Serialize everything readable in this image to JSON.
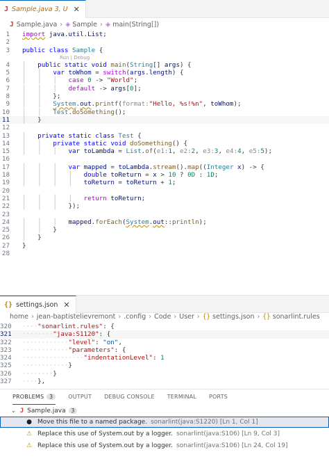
{
  "editor1": {
    "tab": {
      "name": "Sample.java 3, U",
      "icon": "J"
    },
    "breadcrumb": [
      "Sample.java",
      "Sample",
      "main(String[])"
    ],
    "codelens": "Run | Debug",
    "lines": [
      {
        "n": "1",
        "html": "<span class=\"kw2 warn\">import</span> <span class=\"var\">java.util.List</span>;"
      },
      {
        "n": "2",
        "html": ""
      },
      {
        "n": "3",
        "html": "<span class=\"kw\">public</span> <span class=\"kw\">class</span> <span class=\"typ\">Sample</span> {"
      },
      {
        "n": "4",
        "html": "<span class=\"gl\">│</span>   <span class=\"kw\">public</span> <span class=\"kw\">static</span> <span class=\"kw\">void</span> <span class=\"fn\">main</span>(<span class=\"typ\">String</span>[] <span class=\"var\">args</span>) {",
        "lens": true
      },
      {
        "n": "5",
        "html": "<span class=\"gl\">│</span>   <span class=\"gl\">│</span>   <span class=\"kw\">var</span> <span class=\"var\">toWhom</span> = <span class=\"kw2\">switch</span>(<span class=\"var\">args</span>.<span class=\"var\">length</span>) {"
      },
      {
        "n": "6",
        "html": "<span class=\"gl\">│</span>   <span class=\"gl\">│</span>   <span class=\"gl\">│</span>   <span class=\"kw2\">case</span> <span class=\"num\">0</span> -> <span class=\"str\">\"World\"</span>;"
      },
      {
        "n": "7",
        "html": "<span class=\"gl\">│</span>   <span class=\"gl\">│</span>   <span class=\"gl\">│</span>   <span class=\"kw2\">default</span> -> <span class=\"var\">args</span>[<span class=\"num\">0</span>];"
      },
      {
        "n": "8",
        "html": "<span class=\"gl\">│</span>   <span class=\"gl\">│</span>   };"
      },
      {
        "n": "9",
        "html": "<span class=\"gl\">│</span>   <span class=\"gl\">│</span>   <span class=\"typ warn\">System</span>.<span class=\"var warn\">out</span>.<span class=\"fn\">printf</span>(<span class=\"hint\">format:</span><span class=\"str\">\"Hello, %s!%n\"</span>, <span class=\"var\">toWhom</span>);"
      },
      {
        "n": "10",
        "html": "<span class=\"gl\">│</span>   <span class=\"gl\">│</span>   <span class=\"typ\">Test</span>.<span class=\"fn\">doSomething</span>();"
      },
      {
        "n": "11",
        "html": "<span class=\"gl\">│</span>   }",
        "current": true
      },
      {
        "n": "12",
        "html": ""
      },
      {
        "n": "13",
        "html": "<span class=\"gl\">│</span>   <span class=\"kw\">private</span> <span class=\"kw\">static</span> <span class=\"kw\">class</span> <span class=\"typ\">Test</span> {"
      },
      {
        "n": "14",
        "html": "<span class=\"gl\">│</span>   <span class=\"gl\">│</span>   <span class=\"kw\">private</span> <span class=\"kw\">static</span> <span class=\"kw\">void</span> <span class=\"fn\">doSomething</span>() {"
      },
      {
        "n": "15",
        "html": "<span class=\"gl\">│</span>   <span class=\"gl\">│</span>   <span class=\"gl\">│</span>   <span class=\"kw\">var</span> <span class=\"var\">toLambda</span> = <span class=\"typ\">List</span>.<span class=\"fn\">of</span>(<span class=\"hint\">e1:</span><span class=\"num\">1</span>, <span class=\"hint\">e2:</span><span class=\"num\">2</span>, <span class=\"hint\">e3:</span><span class=\"num\">3</span>, <span class=\"hint\">e4:</span><span class=\"num\">4</span>, <span class=\"hint\">e5:</span><span class=\"num\">5</span>);"
      },
      {
        "n": "16",
        "html": ""
      },
      {
        "n": "17",
        "html": "<span class=\"gl\">│</span>   <span class=\"gl\">│</span>   <span class=\"gl\">│</span>   <span class=\"kw\">var</span> <span class=\"var\">mapped</span> = <span class=\"var\">toLambda</span>.<span class=\"fn\">stream</span>().<span class=\"fn\">map</span>((<span class=\"typ\">Integer</span> <span class=\"var\">x</span>) -> {"
      },
      {
        "n": "18",
        "html": "<span class=\"gl\">│</span>   <span class=\"gl\">│</span>   <span class=\"gl\">│</span>   <span class=\"gl\">│</span>   <span class=\"kw\">double</span> <span class=\"var\">toReturn</span> = <span class=\"var\">x</span> > <span class=\"num\">10</span> ? <span class=\"num\">0D</span> : <span class=\"num\">1D</span>;"
      },
      {
        "n": "19",
        "html": "<span class=\"gl\">│</span>   <span class=\"gl\">│</span>   <span class=\"gl\">│</span>   <span class=\"gl\">│</span>   <span class=\"var\">toReturn</span> = <span class=\"var\">toReturn</span> + <span class=\"num\">1</span>;"
      },
      {
        "n": "20",
        "html": ""
      },
      {
        "n": "21",
        "html": "<span class=\"gl\">│</span>   <span class=\"gl\">│</span>   <span class=\"gl\">│</span>   <span class=\"gl\">│</span>   <span class=\"kw2\">return</span> <span class=\"var\">toReturn</span>;"
      },
      {
        "n": "22",
        "html": "<span class=\"gl\">│</span>   <span class=\"gl\">│</span>   <span class=\"gl\">│</span>   });"
      },
      {
        "n": "23",
        "html": ""
      },
      {
        "n": "24",
        "html": "<span class=\"gl\">│</span>   <span class=\"gl\">│</span>   <span class=\"gl\">│</span>   <span class=\"var\">mapped</span>.<span class=\"fn\">forEach</span>(<span class=\"typ warn\">System</span>.<span class=\"var warn\">out</span>::<span class=\"fn\">println</span>);"
      },
      {
        "n": "25",
        "html": "<span class=\"gl\">│</span>   <span class=\"gl\">│</span>   }"
      },
      {
        "n": "26",
        "html": "<span class=\"gl\">│</span>   }"
      },
      {
        "n": "27",
        "html": "}"
      },
      {
        "n": "28",
        "html": ""
      }
    ]
  },
  "editor2": {
    "tab": {
      "name": "settings.json",
      "icon": "{}"
    },
    "breadcrumb": [
      "home",
      "jean-baptistelievremont",
      ".config",
      "Code",
      "User",
      "settings.json",
      "sonarlint.rules"
    ],
    "lines": [
      {
        "n": "320",
        "html": "<span class=\"dots\">····</span><span class=\"jkey\">\"sonarlint.rules\"</span>: {"
      },
      {
        "n": "321",
        "html": "<span class=\"dots\">········</span><span class=\"jkey\">\"java:S1120\"</span>: {",
        "current": true
      },
      {
        "n": "322",
        "html": "<span class=\"dots\">············</span><span class=\"jkey\">\"level\"</span>: <span class=\"jval\">\"on\"</span>,"
      },
      {
        "n": "323",
        "html": "<span class=\"dots\">············</span><span class=\"jkey\">\"parameters\"</span>: {"
      },
      {
        "n": "324",
        "html": "<span class=\"dots\">················</span><span class=\"jkey\">\"indentationLevel\"</span>: <span class=\"jnum\">1</span>"
      },
      {
        "n": "325",
        "html": "<span class=\"dots\">············</span>}"
      },
      {
        "n": "326",
        "html": "<span class=\"dots\">········</span>}"
      },
      {
        "n": "327",
        "html": "<span class=\"dots\">····</span>},"
      }
    ]
  },
  "panel": {
    "tabs": [
      {
        "label": "PROBLEMS",
        "count": "3",
        "active": true
      },
      {
        "label": "OUTPUT"
      },
      {
        "label": "DEBUG CONSOLE"
      },
      {
        "label": "TERMINAL"
      },
      {
        "label": "PORTS"
      }
    ],
    "group": {
      "file": "Sample.java",
      "count": "3"
    },
    "problems": [
      {
        "icon": "lightbulb-icon",
        "message": "Move this file to a named package.",
        "source": "sonarlint(java:S1220)",
        "location": "[Ln 1, Col 1]",
        "selected": true
      },
      {
        "icon": "warning-icon",
        "message": "Replace this use of System.out by a logger.",
        "source": "sonarlint(java:S106)",
        "location": "[Ln 9, Col 3]"
      },
      {
        "icon": "warning-icon",
        "message": "Replace this use of System.out by a logger.",
        "source": "sonarlint(java:S106)",
        "location": "[Ln 24, Col 19]"
      }
    ]
  }
}
